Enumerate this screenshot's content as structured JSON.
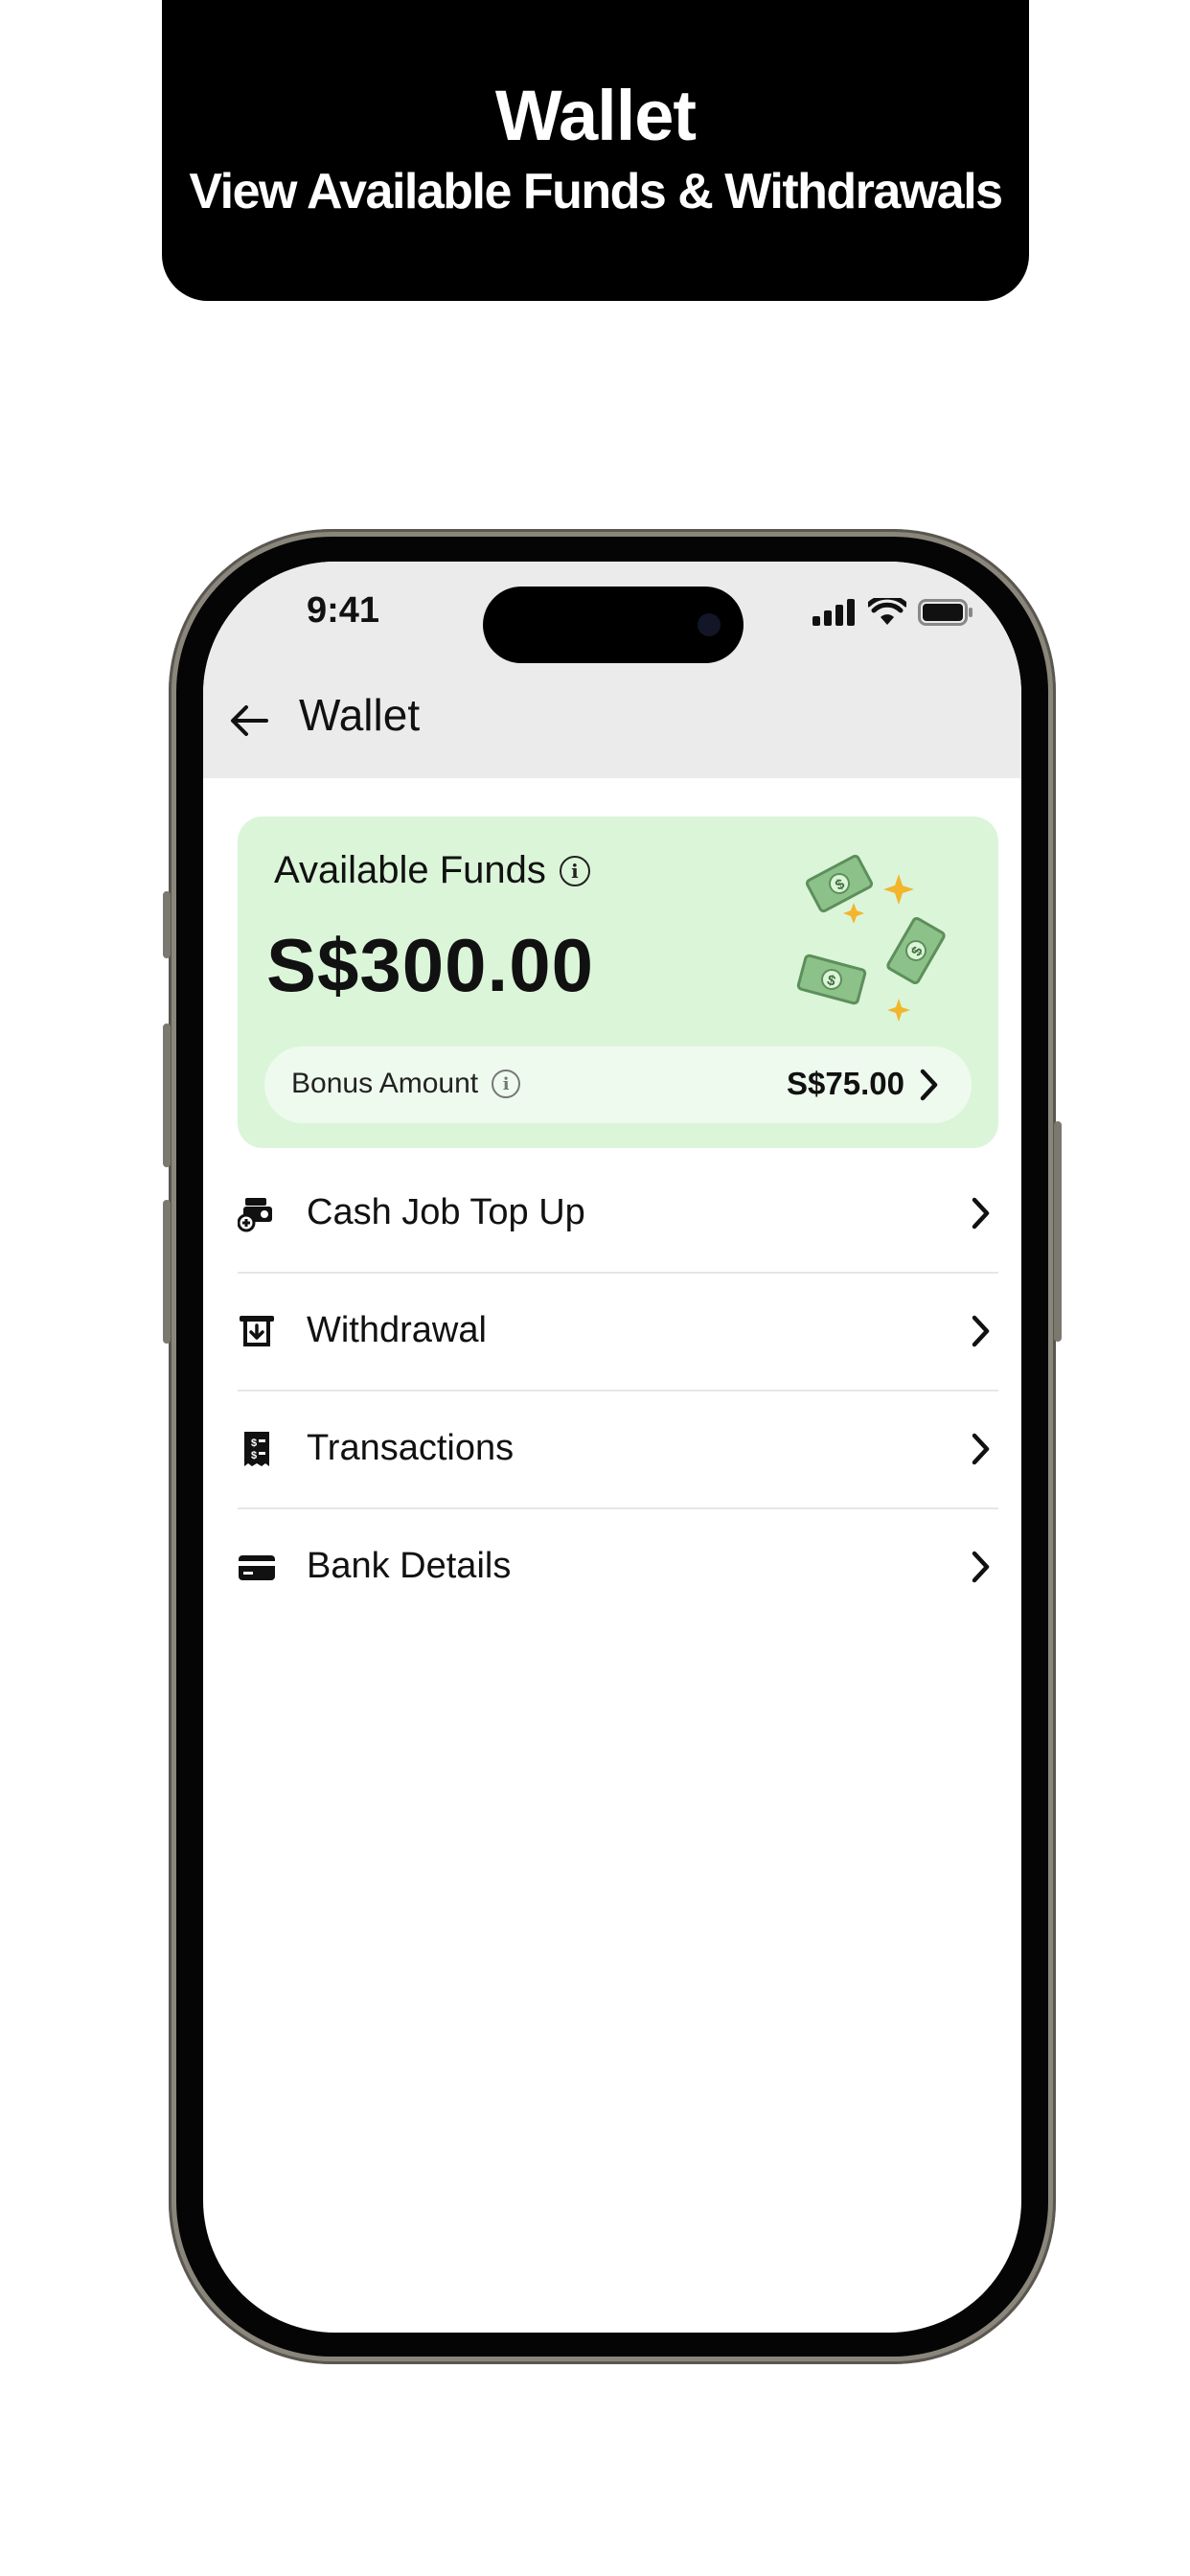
{
  "banner": {
    "title": "Wallet",
    "subtitle": "View Available Funds & Withdrawals"
  },
  "status_bar": {
    "time": "9:41",
    "icons": [
      "signal-icon",
      "wifi-icon",
      "battery-icon"
    ]
  },
  "header": {
    "back_icon": "arrow-left-icon",
    "title": "Wallet"
  },
  "funds_card": {
    "label": "Available Funds",
    "info_icon": "info-icon",
    "amount": "S$300.00",
    "illustration": "flying-money-icon",
    "bonus": {
      "label": "Bonus Amount",
      "value": "S$75.00",
      "icon": "chevron-right-icon"
    }
  },
  "menu": [
    {
      "label": "Cash Job Top Up",
      "icon": "cash-topup-icon"
    },
    {
      "label": "Withdrawal",
      "icon": "atm-withdrawal-icon"
    },
    {
      "label": "Transactions",
      "icon": "receipt-icon"
    },
    {
      "label": "Bank Details",
      "icon": "credit-card-icon"
    }
  ],
  "colors": {
    "banner_bg": "#000000",
    "header_bg": "#ebebeb",
    "card_bg": "#dbf5d9",
    "bonus_bg": "#effaee",
    "money_green": "#7fb07a",
    "sparkle_yellow": "#f2b52c"
  }
}
